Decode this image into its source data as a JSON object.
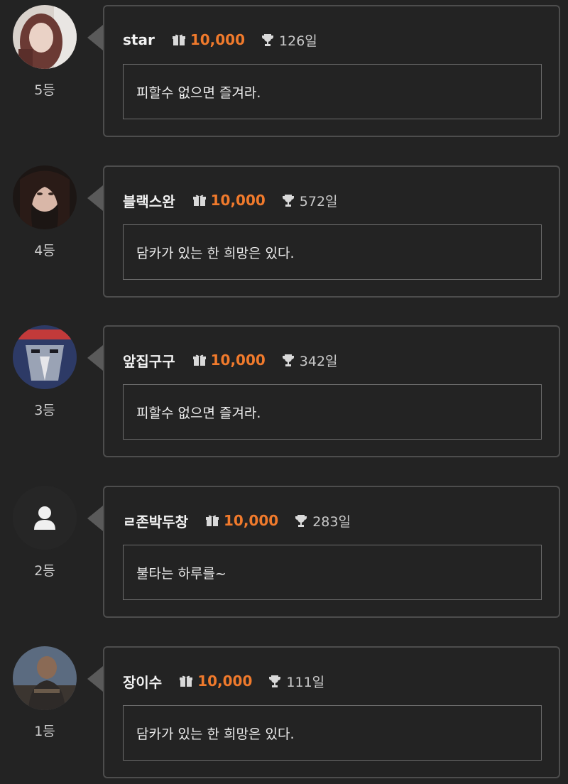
{
  "entries": [
    {
      "rank": "5등",
      "nickname": "star",
      "gift": "10,000",
      "days": "126일",
      "message": "피할수 없으면 즐겨라.",
      "avatar": "photo-woman-light"
    },
    {
      "rank": "4등",
      "nickname": "블랙스완",
      "gift": "10,000",
      "days": "572일",
      "message": "담카가 있는 한 희망은 있다.",
      "avatar": "photo-woman-dark"
    },
    {
      "rank": "3등",
      "nickname": "앞집구구",
      "gift": "10,000",
      "days": "342일",
      "message": "피할수 없으면 즐겨라.",
      "avatar": "bird-character"
    },
    {
      "rank": "2등",
      "nickname": "ㄹ존박두창",
      "gift": "10,000",
      "days": "283일",
      "message": "불타는 하루를~",
      "avatar": "default-user-icon"
    },
    {
      "rank": "1등",
      "nickname": "장이수",
      "gift": "10,000",
      "days": "111일",
      "message": "담카가 있는 한 희망은 있다.",
      "avatar": "photo-man"
    }
  ],
  "colors": {
    "background": "#232323",
    "card_border": "#4d4d4d",
    "gift_amount": "#f07a2c",
    "text": "#e6e6e6"
  }
}
